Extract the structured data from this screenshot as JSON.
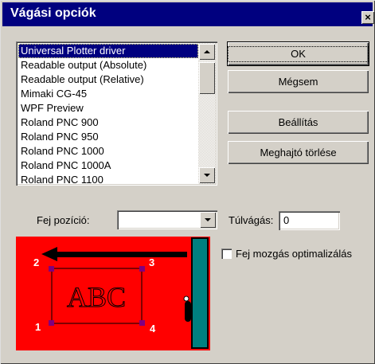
{
  "window": {
    "title": "Vágási opciók",
    "close_glyph": "×"
  },
  "driver_list": {
    "items": [
      "Universal Plotter driver",
      "Readable output (Absolute)",
      "Readable output (Relative)",
      "Mimaki CG-45",
      "WPF Preview",
      "Roland PNC 900",
      "Roland PNC 950",
      "Roland PNC 1000",
      "Roland PNC 1000A",
      "Roland PNC 1100"
    ],
    "selected": "Universal Plotter driver"
  },
  "buttons": {
    "ok": "OK",
    "cancel": "Mégsem",
    "settings": "Beállítás",
    "delete_driver": "Meghajtó törlése"
  },
  "head_position": {
    "label": "Fej pozíció:",
    "value": ""
  },
  "overcut": {
    "label": "Túlvágás:",
    "value": "0"
  },
  "optimize": {
    "label": "Fej mozgás optimalizálás",
    "checked": false
  },
  "preview": {
    "text": "ABC",
    "corners": [
      "1",
      "2",
      "3",
      "4"
    ],
    "colors": {
      "background": "#ff0000",
      "bar": "#008080",
      "marker": "#800080"
    }
  }
}
